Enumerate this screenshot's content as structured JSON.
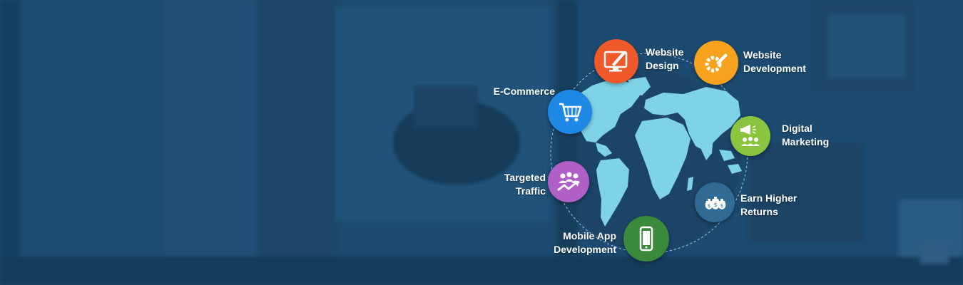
{
  "services": {
    "website_design": {
      "line1": "Website",
      "line2": "Design",
      "color": "#f0592a",
      "icon": "monitor-pen-icon"
    },
    "website_development": {
      "line1": "Website",
      "line2": "Development",
      "color": "#f6a21c",
      "icon": "gear-pencil-icon"
    },
    "ecommerce": {
      "line1": "E-Commerce",
      "color": "#1e88e5",
      "icon": "shopping-cart-icon"
    },
    "digital_marketing": {
      "line1": "Digital",
      "line2": "Marketing",
      "color": "#8bc53f",
      "icon": "megaphone-people-icon"
    },
    "targeted_traffic": {
      "line1": "Targeted",
      "line2": "Traffic",
      "color": "#b05fc7",
      "icon": "people-trend-icon"
    },
    "earn_higher_returns": {
      "line1": "Earn Higher",
      "line2": "Returns",
      "color": "#2f6b94",
      "icon": "money-bags-icon"
    },
    "mobile_app_development": {
      "line1": "Mobile App",
      "line2": "Development",
      "color": "#3a8a3c",
      "icon": "smartphone-icon"
    }
  },
  "colors": {
    "background": "#1b4a70",
    "continents": "#7fd3e6"
  }
}
